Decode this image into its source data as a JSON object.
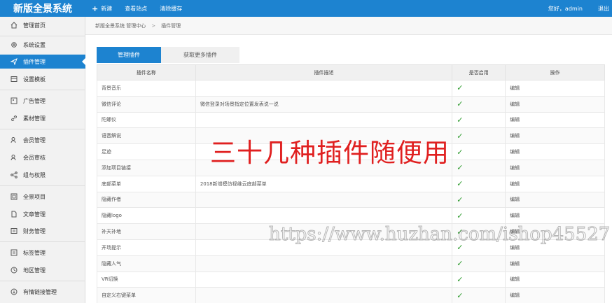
{
  "app": {
    "title": "新版全景系统"
  },
  "topnav": {
    "new_label": "新建",
    "view_site_label": "查看站点",
    "clear_cache_label": "清除缓存",
    "greeting": "您好，admin",
    "logout_label": "退出"
  },
  "sidebar": {
    "items": [
      {
        "label": "管理首页",
        "icon": "home-icon"
      },
      {
        "label": "系统设置",
        "icon": "gear-icon"
      },
      {
        "label": "插件管理",
        "icon": "send-icon"
      },
      {
        "label": "设置模板",
        "icon": "template-icon"
      },
      {
        "label": "广告管理",
        "icon": "ad-icon"
      },
      {
        "label": "素材管理",
        "icon": "link-icon"
      },
      {
        "label": "会员管理",
        "icon": "users-icon"
      },
      {
        "label": "会员审核",
        "icon": "user-check-icon"
      },
      {
        "label": "组与权限",
        "icon": "share-icon"
      },
      {
        "label": "全景项目",
        "icon": "panorama-icon"
      },
      {
        "label": "文章管理",
        "icon": "document-icon"
      },
      {
        "label": "财务管理",
        "icon": "finance-icon"
      },
      {
        "label": "标签管理",
        "icon": "tag-icon"
      },
      {
        "label": "地区管理",
        "icon": "region-icon"
      },
      {
        "label": "有情链接管理",
        "icon": "link-circle-icon"
      }
    ]
  },
  "breadcrumb": {
    "root": "新版全景系统 管理中心",
    "separator": ">",
    "current": "插件管理"
  },
  "tabs": {
    "active": "管理插件",
    "more": "获取更多插件"
  },
  "table": {
    "headers": [
      "插件名称",
      "插件描述",
      "是否启用",
      "操作"
    ],
    "rows": [
      {
        "name": "背景音乐",
        "desc": "",
        "enabled": "✓",
        "action": "编辑"
      },
      {
        "name": "微信评论",
        "desc": "微信登录对场景指定位置发表说一说",
        "enabled": "✓",
        "action": "编辑"
      },
      {
        "name": "陀螺仪",
        "desc": "",
        "enabled": "✓",
        "action": "编辑"
      },
      {
        "name": "语音解说",
        "desc": "",
        "enabled": "✓",
        "action": "编辑"
      },
      {
        "name": "足迹",
        "desc": "",
        "enabled": "✓",
        "action": "编辑"
      },
      {
        "name": "添加项目链接",
        "desc": "",
        "enabled": "✓",
        "action": "编辑"
      },
      {
        "name": "底部菜单",
        "desc": "2018新增模仿视维云底部菜单",
        "enabled": "✓",
        "action": "编辑"
      },
      {
        "name": "隐藏作者",
        "desc": "",
        "enabled": "✓",
        "action": "编辑"
      },
      {
        "name": "隐藏logo",
        "desc": "",
        "enabled": "✓",
        "action": "编辑"
      },
      {
        "name": "补天补地",
        "desc": "",
        "enabled": "✓",
        "action": "编辑"
      },
      {
        "name": "开场提示",
        "desc": "",
        "enabled": "✓",
        "action": "编辑"
      },
      {
        "name": "隐藏人气",
        "desc": "",
        "enabled": "✓",
        "action": "编辑"
      },
      {
        "name": "VR切换",
        "desc": "",
        "enabled": "✓",
        "action": "编辑"
      },
      {
        "name": "自定义右键菜单",
        "desc": "",
        "enabled": "✓",
        "action": "编辑"
      }
    ]
  },
  "overlays": {
    "promo_text": "三十几种插件随便用",
    "watermark_url": "https://www.huzhan.com/ishop45527"
  },
  "colors": {
    "primary": "#1d83d0",
    "check": "#2e9b2e",
    "promo": "#e02020"
  }
}
